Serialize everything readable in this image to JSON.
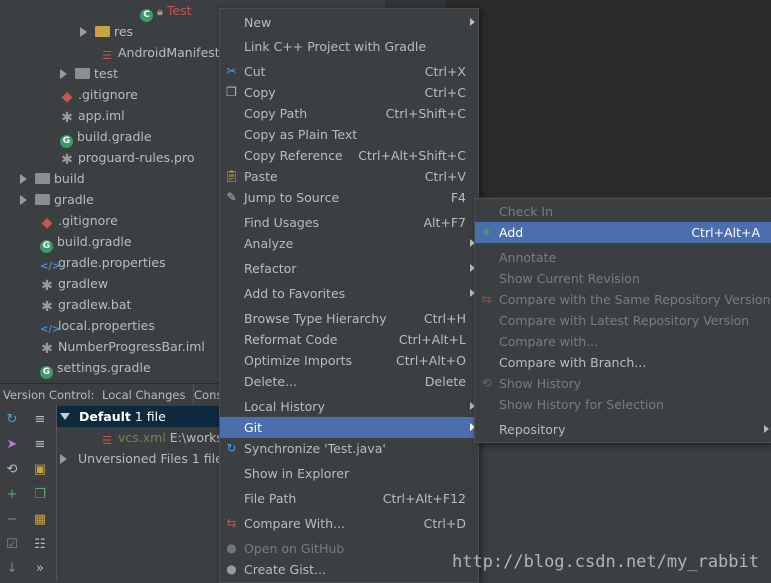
{
  "tree": {
    "tab_file": "Test",
    "items": [
      {
        "label": "res",
        "icon": "folder-res-icon"
      },
      {
        "label": "AndroidManifest.",
        "icon": "xml-icon"
      },
      {
        "label": "test",
        "icon": "folder-icon"
      },
      {
        "label": ".gitignore",
        "icon": "gitignore-icon"
      },
      {
        "label": "app.iml",
        "icon": "iml-icon"
      },
      {
        "label": "build.gradle",
        "icon": "gradle-icon"
      },
      {
        "label": "proguard-rules.pro",
        "icon": "file-icon"
      },
      {
        "label": "build",
        "icon": "folder-icon"
      },
      {
        "label": "gradle",
        "icon": "folder-icon"
      },
      {
        "label": ".gitignore",
        "icon": "gitignore-icon"
      },
      {
        "label": "build.gradle",
        "icon": "gradle-icon"
      },
      {
        "label": "gradle.properties",
        "icon": "properties-icon"
      },
      {
        "label": "gradlew",
        "icon": "file-icon"
      },
      {
        "label": "gradlew.bat",
        "icon": "file-icon"
      },
      {
        "label": "local.properties",
        "icon": "properties-icon"
      },
      {
        "label": "NumberProgressBar.iml",
        "icon": "iml-icon"
      },
      {
        "label": "settings.gradle",
        "icon": "gradle-icon"
      }
    ]
  },
  "vcs": {
    "tabs": [
      "Version Control:",
      "Local Changes",
      "Cons"
    ],
    "default_label": "Default",
    "default_count": "1 file",
    "file": "vcs.xml",
    "file_path": "E:\\worksp",
    "unversioned": "Unversioned Files",
    "unversioned_count": "1 file"
  },
  "context_menu": [
    {
      "label": "New",
      "shortcut": "",
      "sub": true
    },
    {
      "label": "Link C++ Project with Gradle",
      "shortcut": ""
    },
    {
      "label": "Cut",
      "shortcut": "Ctrl+X",
      "icon": "scissors-icon"
    },
    {
      "label": "Copy",
      "shortcut": "Ctrl+C",
      "icon": "copy-icon"
    },
    {
      "label": "Copy Path",
      "shortcut": "Ctrl+Shift+C"
    },
    {
      "label": "Copy as Plain Text",
      "shortcut": ""
    },
    {
      "label": "Copy Reference",
      "shortcut": "Ctrl+Alt+Shift+C"
    },
    {
      "label": "Paste",
      "shortcut": "Ctrl+V",
      "icon": "paste-icon"
    },
    {
      "label": "Jump to Source",
      "shortcut": "F4",
      "icon": "jump-icon"
    },
    {
      "label": "Find Usages",
      "shortcut": "Alt+F7"
    },
    {
      "label": "Analyze",
      "shortcut": "",
      "sub": true
    },
    {
      "label": "Refactor",
      "shortcut": "",
      "sub": true
    },
    {
      "label": "Add to Favorites",
      "shortcut": "",
      "sub": true
    },
    {
      "label": "Browse Type Hierarchy",
      "shortcut": "Ctrl+H"
    },
    {
      "label": "Reformat Code",
      "shortcut": "Ctrl+Alt+L"
    },
    {
      "label": "Optimize Imports",
      "shortcut": "Ctrl+Alt+O"
    },
    {
      "label": "Delete...",
      "shortcut": "Delete"
    },
    {
      "label": "Local History",
      "shortcut": "",
      "sub": true
    },
    {
      "label": "Git",
      "shortcut": "",
      "sub": true,
      "highlight": true
    },
    {
      "label": "Synchronize 'Test.java'",
      "shortcut": "",
      "icon": "sync-icon"
    },
    {
      "label": "Show in Explorer",
      "shortcut": ""
    },
    {
      "label": "File Path",
      "shortcut": "Ctrl+Alt+F12"
    },
    {
      "label": "Compare With...",
      "shortcut": "Ctrl+D",
      "icon": "compare-icon"
    },
    {
      "label": "Open on GitHub",
      "shortcut": "",
      "disabled": true,
      "icon": "github-icon"
    },
    {
      "label": "Create Gist...",
      "shortcut": "",
      "icon": "github-icon"
    }
  ],
  "git_menu": [
    {
      "label": "Check In",
      "shortcut": "",
      "disabled": true
    },
    {
      "label": "Add",
      "shortcut": "Ctrl+Alt+A",
      "highlight": true,
      "icon": "plus-icon"
    },
    {
      "label": "Annotate",
      "shortcut": "",
      "disabled": true
    },
    {
      "label": "Show Current Revision",
      "shortcut": "",
      "disabled": true
    },
    {
      "label": "Compare with the Same Repository Version",
      "shortcut": "",
      "disabled": true,
      "icon": "compare-icon"
    },
    {
      "label": "Compare with Latest Repository Version",
      "shortcut": "",
      "disabled": true
    },
    {
      "label": "Compare with...",
      "shortcut": "",
      "disabled": true
    },
    {
      "label": "Compare with Branch...",
      "shortcut": ""
    },
    {
      "label": "Show History",
      "shortcut": "",
      "disabled": true,
      "icon": "history-icon"
    },
    {
      "label": "Show History for Selection",
      "shortcut": "",
      "disabled": true
    },
    {
      "label": "Repository",
      "shortcut": "",
      "sub": true
    }
  ],
  "watermark": "http://blog.csdn.net/my_rabbit",
  "colors": {
    "highlight": "#4b6eaf",
    "background": "#3c3f41",
    "disabled": "#7a7d80"
  }
}
